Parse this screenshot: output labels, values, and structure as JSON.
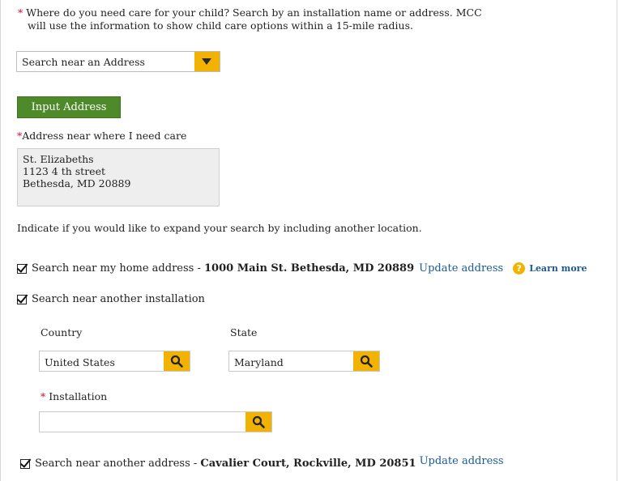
{
  "intro": {
    "required_mark": "*",
    "line1": "Where do you need care for your child? Search by an installation name or address. MCC",
    "line2": "will use the information to show child care options within a 15-mile radius."
  },
  "location_select": {
    "value": "Search near an Address",
    "arrow_icon": "caret-down-icon"
  },
  "input_address_button": "Input Address",
  "address": {
    "required_mark": "*",
    "label": "Address near where I need care",
    "lines": [
      "St. Elizabeths",
      "1123 4 th street",
      "Bethesda, MD 20889"
    ]
  },
  "expand_text": "Indicate if you would like to expand your search by including another location.",
  "home_option": {
    "checked": true,
    "label": "Search near my home address - ",
    "address": "1000 Main St. Bethesda, MD 20889",
    "update_link": "Update address",
    "help_icon": "?",
    "learn_more": "Learn more"
  },
  "installation_option": {
    "checked": true,
    "label": "Search near another installation",
    "country": {
      "label": "Country",
      "value": "United States"
    },
    "state": {
      "label": "State",
      "value": "Maryland"
    },
    "installation": {
      "required_mark": "*",
      "label": "Installation",
      "value": ""
    }
  },
  "another_address_option": {
    "checked": true,
    "label": "Search near another address - ",
    "address": "Cavalier Court, Rockville, MD 20851",
    "update_link": "Update address"
  },
  "colors": {
    "accent": "#f2b300",
    "button_green": "#4f8a2a",
    "link": "#1a5a99",
    "required": "#c8102e"
  }
}
